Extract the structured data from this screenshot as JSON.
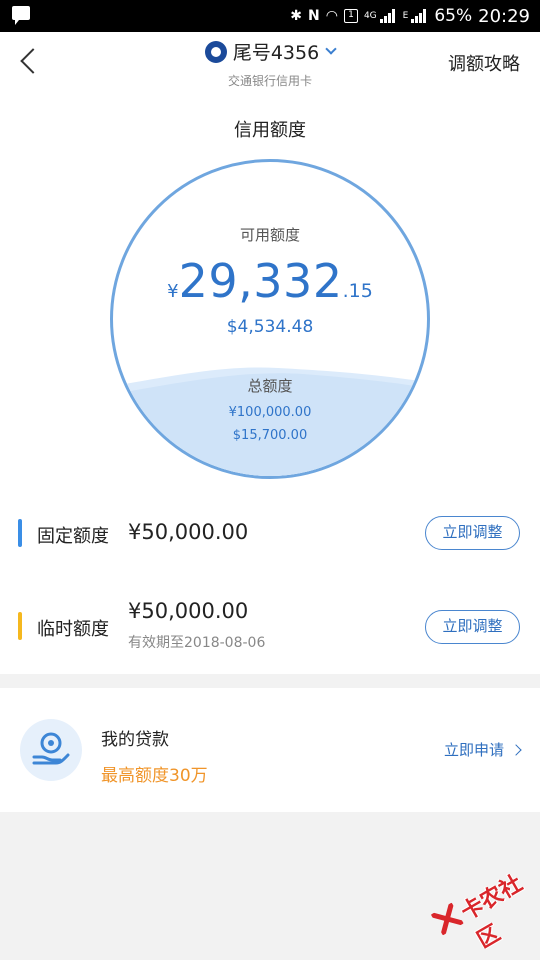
{
  "status_bar": {
    "net_badge": "1",
    "net_type_1": "4G",
    "net_type_2": "E",
    "battery": "65%",
    "time": "20:29"
  },
  "header": {
    "card_number": "尾号4356",
    "bank_name": "交通银行信用卡",
    "strategy_link": "调额攻略"
  },
  "credit": {
    "title": "信用额度",
    "available_label": "可用额度",
    "available_symbol": "¥",
    "available_int": "29,332",
    "available_dec": ".15",
    "available_usd": "$4,534.48",
    "total_label": "总额度",
    "total_cny": "¥100,000.00",
    "total_usd": "$15,700.00"
  },
  "fixed": {
    "label": "固定额度",
    "amount": "¥50,000.00",
    "button": "立即调整",
    "accent": "#3a8ee6"
  },
  "temporary": {
    "label": "临时额度",
    "amount": "¥50,000.00",
    "expiry": "有效期至2018-08-06",
    "button": "立即调整",
    "accent": "#f5b81f"
  },
  "loan": {
    "icon": "loan-hand-coin-icon",
    "title": "我的贷款",
    "limit": "最高额度30万",
    "apply": "立即申请"
  },
  "watermark": {
    "text": "卡农社区"
  },
  "colors": {
    "primary_blue": "#2f74c9",
    "orange": "#f0952a",
    "background": "#f2f2f2"
  }
}
